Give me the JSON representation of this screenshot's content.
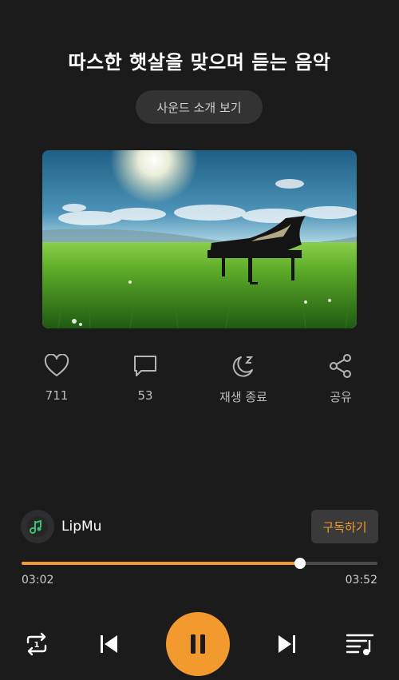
{
  "header": {
    "title": "따스한 햇살을 맞으며 듣는 음악"
  },
  "intro_button": {
    "label": "사운드 소개 보기"
  },
  "actions": {
    "like": {
      "icon": "heart-icon",
      "count": "711"
    },
    "comment": {
      "icon": "comment-icon",
      "count": "53"
    },
    "sleep_timer": {
      "icon": "moon-sleep-icon",
      "label": "재생 종료"
    },
    "share": {
      "icon": "share-icon",
      "label": "공유"
    }
  },
  "channel": {
    "name": "LipMu",
    "subscribe_label": "구독하기"
  },
  "player": {
    "current_time": "03:02",
    "total_time": "03:52",
    "progress": 0.783,
    "accent_color": "#f29a2e"
  },
  "controls": [
    "repeat-one-icon",
    "previous-icon",
    "pause-icon",
    "next-icon",
    "playlist-icon"
  ]
}
